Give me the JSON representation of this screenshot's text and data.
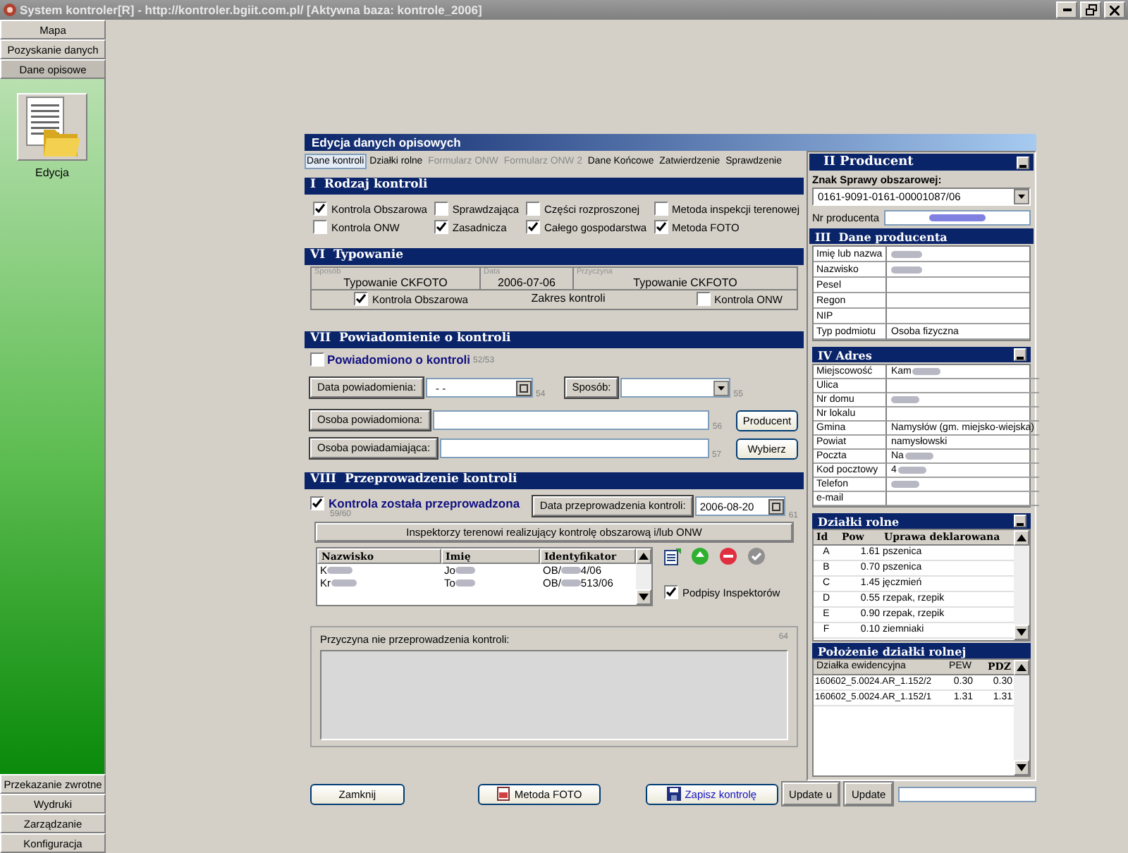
{
  "window": {
    "title": "System kontroler[R] - http://kontroler.bgiit.com.pl/ [Aktywna baza: kontrole_2006]"
  },
  "sidebar": {
    "top_items": [
      {
        "label": "Mapa",
        "selected": false
      },
      {
        "label": "Pozyskanie danych",
        "selected": false
      },
      {
        "label": "Dane opisowe",
        "selected": true
      }
    ],
    "module": {
      "label": "Edycja"
    },
    "bottom_items": [
      {
        "label": "Przekazanie zwrotne",
        "selected": false
      },
      {
        "label": "Wydruki",
        "selected": false
      },
      {
        "label": "Zarządzanie",
        "selected": false
      },
      {
        "label": "Konfiguracja",
        "selected": false
      }
    ]
  },
  "form": {
    "title": "Edycja danych opisowych",
    "tabs": [
      {
        "label": "Dane kontroli",
        "selected": true,
        "disabled": false
      },
      {
        "label": "Działki rolne",
        "selected": false,
        "disabled": false
      },
      {
        "label": "Formularz ONW",
        "selected": false,
        "disabled": true
      },
      {
        "label": "Formularz ONW 2",
        "selected": false,
        "disabled": true
      },
      {
        "label": "Dane Końcowe",
        "selected": false,
        "disabled": false
      },
      {
        "label": "Zatwierdzenie",
        "selected": false,
        "disabled": false
      },
      {
        "label": "Sprawdzenie",
        "selected": false,
        "disabled": false
      }
    ]
  },
  "rodzaj": {
    "title": "I  Rodzaj kontroli",
    "checkboxes": [
      {
        "label": "Kontrola Obszarowa",
        "checked": true
      },
      {
        "label": "Sprawdzająca",
        "checked": false
      },
      {
        "label": "Części rozproszonej",
        "checked": false
      },
      {
        "label": "Metoda inspekcji terenowej",
        "checked": false
      },
      {
        "label": "Kontrola ONW",
        "checked": false
      },
      {
        "label": "Zasadnicza",
        "checked": true
      },
      {
        "label": "Całego gospodarstwa",
        "checked": true
      },
      {
        "label": "Metoda FOTO",
        "checked": true
      }
    ]
  },
  "typowanie": {
    "title": "VI  Typowanie",
    "cells": [
      {
        "caption": "Sposób",
        "value": "Typowanie CKFOTO"
      },
      {
        "caption": "Data",
        "value": "2006-07-06"
      },
      {
        "caption": "Przyczyna",
        "value": "Typowanie CKFOTO"
      }
    ],
    "scope_title": "Zakres kontroli",
    "scope": [
      {
        "label": "Kontrola Obszarowa",
        "checked": true
      },
      {
        "label": "Kontrola ONW",
        "checked": false
      }
    ]
  },
  "powiadomienie": {
    "title": "VII  Powiadomienie o kontroli",
    "notified": {
      "label": "Powiadomiono o kontroli",
      "checked": false,
      "code": "52/53"
    },
    "date": {
      "label": "Data powiadomienia:",
      "value": "- -",
      "code": "54"
    },
    "method": {
      "label": "Sposób:",
      "code": "55"
    },
    "persons": [
      {
        "label": "Osoba powiadomiona:",
        "code": "56",
        "button": "Producent"
      },
      {
        "label": "Osoba powiadamiająca:",
        "code": "57",
        "button": "Wybierz"
      }
    ]
  },
  "przeprowadzenie": {
    "title": "VIII  Przeprowadzenie kontroli",
    "done": {
      "label": "Kontrola została przeprowadzona",
      "checked": true,
      "code": "59/60"
    },
    "date": {
      "label": "Data przeprowadzenia kontroli:",
      "value": "2006-08-20",
      "code": "61"
    },
    "inspectors_title": "Inspektorzy terenowi realizujący kontrolę obszarową i/lub ONW",
    "columns": [
      "Nazwisko",
      "Imię",
      "Identyfikator"
    ],
    "rows": [
      {
        "surname": "K",
        "name": "Jo",
        "id_start": "OB/",
        "id_end": "4/06"
      },
      {
        "surname": "Kr",
        "name": "To",
        "id_start": "OB/",
        "id_end": "513/06"
      }
    ],
    "signatures": {
      "label": "Podpisy Inspektorów",
      "checked": true
    },
    "reason": {
      "label": "Przyczyna nie przeprowadzenia kontroli:",
      "code": "64"
    }
  },
  "buttons": [
    {
      "label": "Zamknij",
      "kind": "plain"
    },
    {
      "label": "Metoda FOTO",
      "kind": "photo"
    },
    {
      "label": "Zapisz kontrolę",
      "kind": "save"
    },
    {
      "label": "Update u",
      "kind": "small"
    },
    {
      "label": "Update",
      "kind": "small"
    }
  ],
  "producer": {
    "title": "II Producent",
    "case_label": "Znak Sprawy obszarowej:",
    "case_value": "0161-9091-0161-00001087/06",
    "nr_label": "Nr producenta"
  },
  "producer_data": {
    "title": "III  Dane producenta",
    "rows": [
      {
        "label": "Imię lub nazwa",
        "masked": true
      },
      {
        "label": "Nazwisko",
        "masked": true
      },
      {
        "label": "Pesel",
        "masked": false
      },
      {
        "label": "Regon",
        "masked": false
      },
      {
        "label": "NIP",
        "masked": false
      },
      {
        "label": "Typ podmiotu",
        "value": "Osoba fizyczna",
        "masked": false
      }
    ]
  },
  "address": {
    "title": "IV Adres",
    "rows": [
      {
        "label": "Miejscowość",
        "value": "Kam",
        "masked": true
      },
      {
        "label": "Ulica",
        "masked": false
      },
      {
        "label": "Nr domu",
        "masked": true
      },
      {
        "label": "Nr lokalu",
        "masked": false
      },
      {
        "label": "Gmina",
        "value": "Namysłów (gm. miejsko-wiejska)",
        "masked": false
      },
      {
        "label": "Powiat",
        "value": "namysłowski",
        "masked": false
      },
      {
        "label": "Poczta",
        "value": "Na",
        "masked": true
      },
      {
        "label": "Kod pocztowy",
        "value": "4",
        "masked": true
      },
      {
        "label": "Telefon",
        "masked": true
      },
      {
        "label": "e-mail",
        "masked": false
      }
    ]
  },
  "plots": {
    "title": "Działki rolne",
    "columns": [
      "Id",
      "Pow",
      "Uprawa deklarowana"
    ],
    "rows": [
      {
        "id": "A",
        "area": "1.61",
        "crop": "pszenica"
      },
      {
        "id": "B",
        "area": "0.70",
        "crop": "pszenica"
      },
      {
        "id": "C",
        "area": "1.45",
        "crop": "jęczmień"
      },
      {
        "id": "D",
        "area": "0.55",
        "crop": "rzepak, rzepik"
      },
      {
        "id": "E",
        "area": "0.90",
        "crop": "rzepak, rzepik"
      },
      {
        "id": "F",
        "area": "0.10",
        "crop": "ziemniaki"
      }
    ]
  },
  "location": {
    "title": "Położenie działki rolnej",
    "columns": [
      "Działka ewidencyjna",
      "PEW",
      "PDZ"
    ],
    "rows": [
      {
        "parcel": "160602_5.0024.AR_1.152/2",
        "pew": "0.30",
        "pdz": "0.30"
      },
      {
        "parcel": "160602_5.0024.AR_1.152/1",
        "pew": "1.31",
        "pdz": "1.31"
      }
    ]
  }
}
